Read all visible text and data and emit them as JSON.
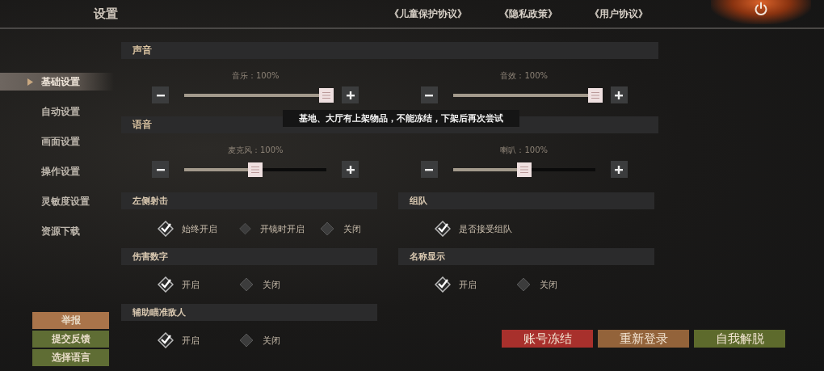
{
  "title": "设置",
  "links": [
    "《儿童保护协议》",
    "《隐私政策》",
    "《用户协议》"
  ],
  "sidebar": {
    "items": [
      {
        "label": "基础设置",
        "selected": true
      },
      {
        "label": "自动设置",
        "selected": false
      },
      {
        "label": "画面设置",
        "selected": false
      },
      {
        "label": "操作设置",
        "selected": false
      },
      {
        "label": "灵敏度设置",
        "selected": false
      },
      {
        "label": "资源下载",
        "selected": false
      }
    ],
    "buttons": [
      {
        "label": "举报",
        "color": "#a9744a"
      },
      {
        "label": "提交反馈",
        "color": "#5f6d34"
      },
      {
        "label": "选择语言",
        "color": "#5f6d34"
      }
    ]
  },
  "sections": [
    {
      "title": "声音",
      "sliders": [
        {
          "label": "音乐：100%",
          "level": 1
        },
        {
          "label": "音效：100%",
          "level": 1
        }
      ]
    },
    {
      "title": "语音",
      "sliders": [
        {
          "label": "麦克风：100%",
          "level": 0.5
        },
        {
          "label": "喇叭：100%",
          "level": 0.5
        }
      ]
    }
  ],
  "toast": "基地、大厅有上架物品，不能冻结，下架后再次尝试",
  "toggle_groups": [
    {
      "title": "左侧射击",
      "options": [
        {
          "label": "始终开启",
          "selected": true
        },
        {
          "label": "开镜时开启",
          "selected": false
        },
        {
          "label": "关闭",
          "selected": false
        }
      ]
    },
    {
      "title": "组队",
      "options": [
        {
          "label": "是否接受组队",
          "selected": true
        }
      ]
    },
    {
      "title": "伤害数字",
      "options": [
        {
          "label": "开启",
          "selected": true
        },
        {
          "label": "关闭",
          "selected": false
        }
      ]
    },
    {
      "title": "名称显示",
      "options": [
        {
          "label": "开启",
          "selected": true
        },
        {
          "label": "关闭",
          "selected": false
        }
      ]
    },
    {
      "title": "辅助瞄准敌人",
      "options": [
        {
          "label": "开启",
          "selected": true
        },
        {
          "label": "关闭",
          "selected": false
        }
      ]
    }
  ],
  "actions": [
    {
      "label": "账号冻结",
      "color": "#a8302c"
    },
    {
      "label": "重新登录",
      "color": "#93633a"
    },
    {
      "label": "自我解脱",
      "color": "#5d6a2c"
    }
  ]
}
